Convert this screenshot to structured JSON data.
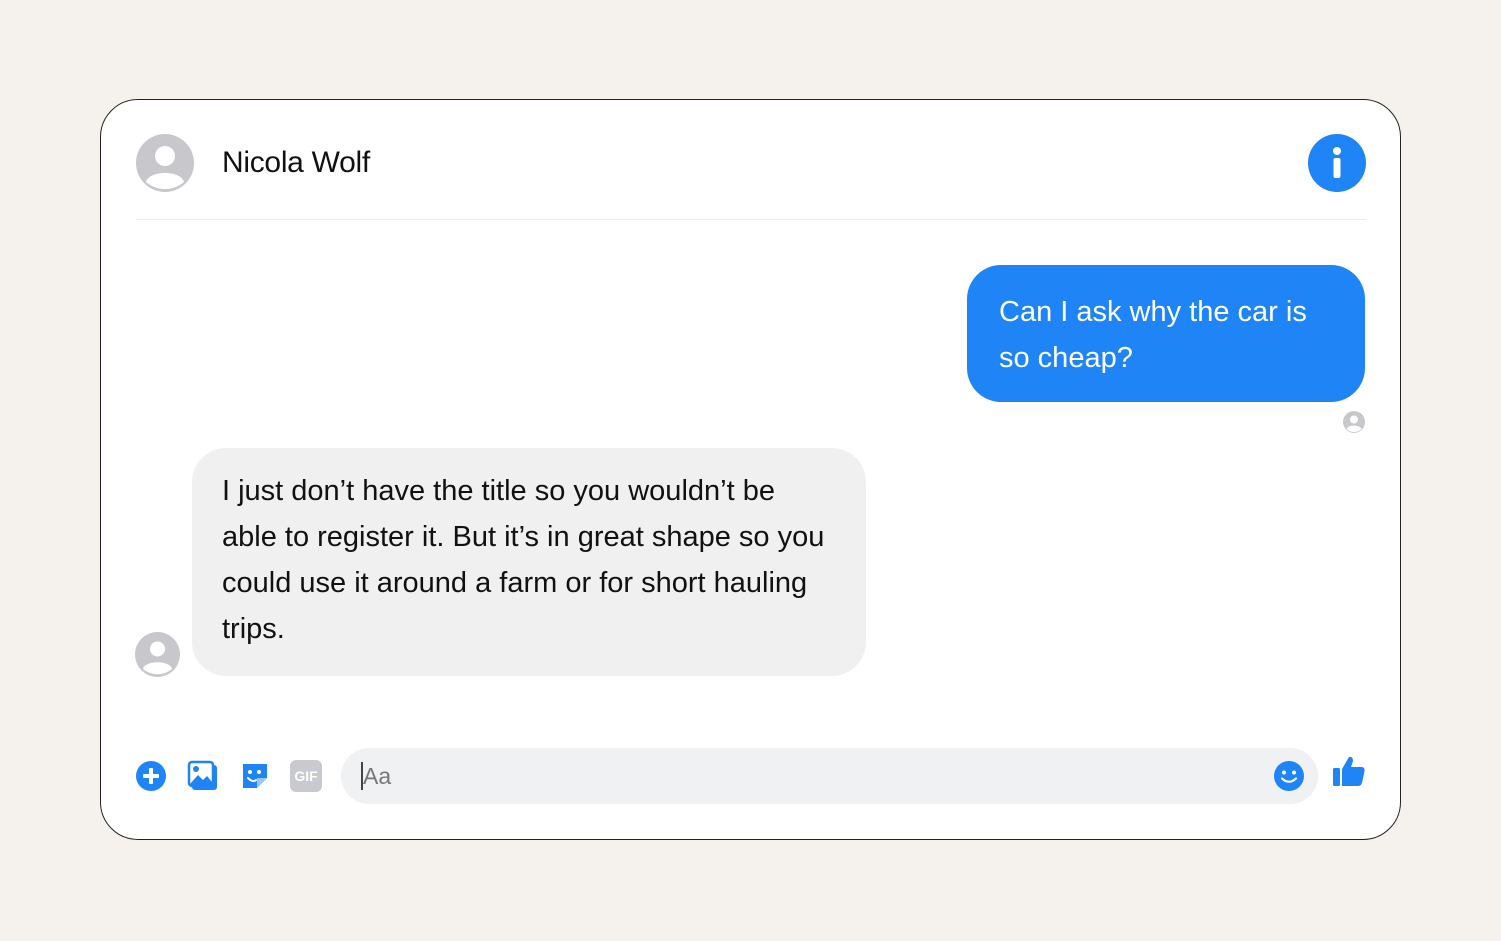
{
  "header": {
    "contact_name": "Nicola Wolf",
    "info_icon": "info-icon"
  },
  "messages": [
    {
      "direction": "outgoing",
      "text": "Can I ask why the car is so cheap?"
    },
    {
      "direction": "incoming",
      "text": "I just don’t have the title so you wouldn’t be able to register it. But it’s in great shape so you could use it around a farm or for short hauling trips."
    }
  ],
  "composer": {
    "placeholder": "Aa",
    "value": "",
    "icons": [
      "plus-icon",
      "photo-icon",
      "sticker-icon",
      "gif-icon",
      "emoji-icon",
      "thumbs-up-icon"
    ],
    "gif_label": "GIF"
  },
  "colors": {
    "accent": "#1f84f5",
    "incoming_bubble": "#f0f0f0",
    "avatar": "#c8c8cc",
    "page_background": "#f5f2ee"
  }
}
